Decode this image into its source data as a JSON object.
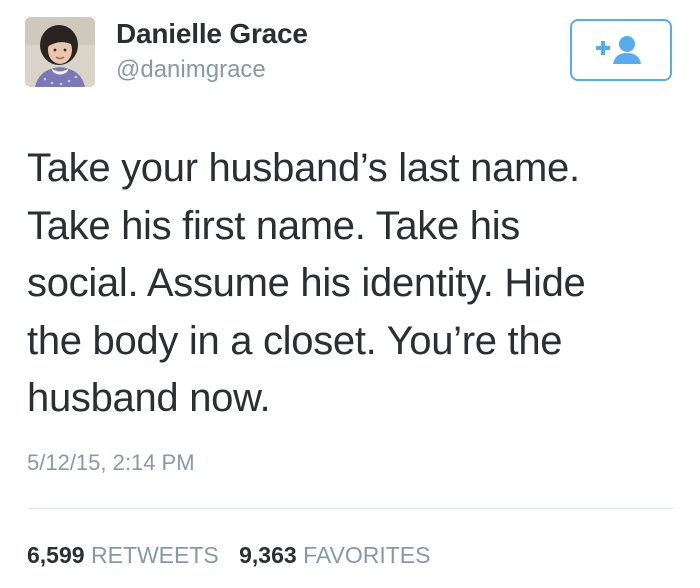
{
  "user": {
    "display_name": "Danielle Grace",
    "handle": "@danimgrace",
    "avatar_icon": "profile-photo"
  },
  "follow_button": {
    "icon": "add-user-icon",
    "color": "#55acee"
  },
  "tweet": {
    "lines": [
      "Take your husband’s last name.",
      "Take his first name. Take his",
      "social. Assume his identity. Hide",
      "the body in a closet. You’re the",
      "husband now."
    ],
    "timestamp": "5/12/15, 2:14 PM"
  },
  "stats": {
    "retweets_count": "6,599",
    "retweets_label": "RETWEETS",
    "favorites_count": "9,363",
    "favorites_label": "FAVORITES"
  },
  "colors": {
    "text": "#292f33",
    "muted": "#8899a6",
    "accent": "#55acee",
    "divider": "#e1e8ed"
  }
}
